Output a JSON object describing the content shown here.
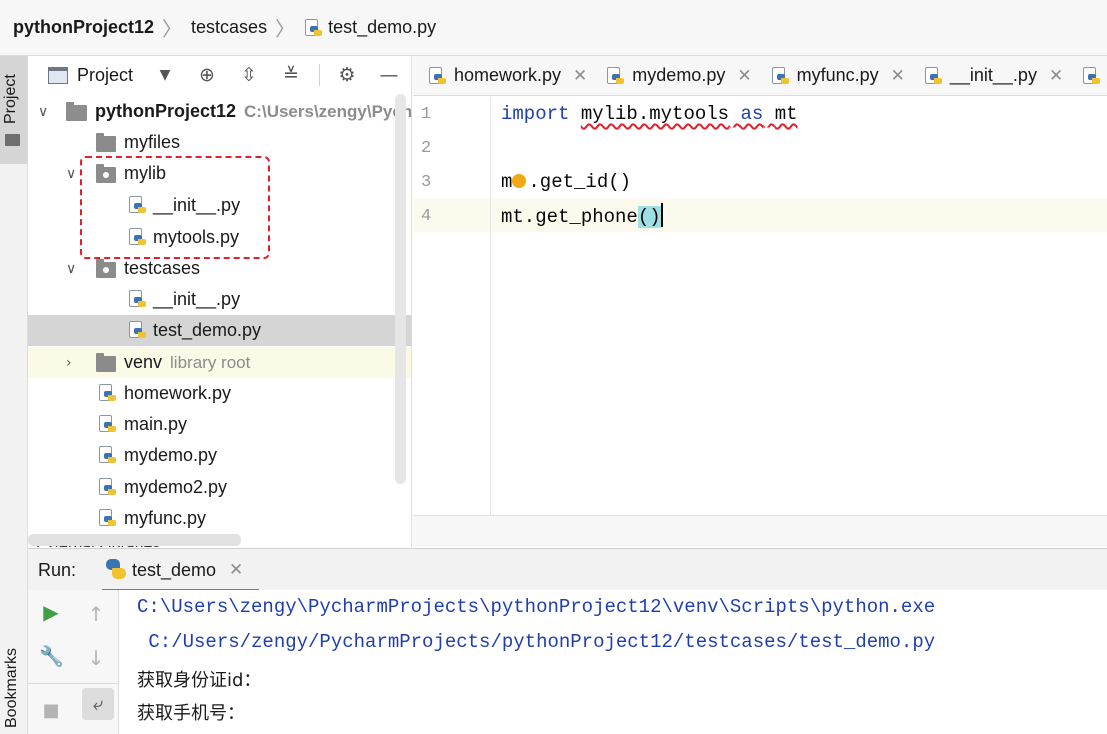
{
  "breadcrumb": {
    "project": "pythonProject12",
    "folder": "testcases",
    "file": "test_demo.py"
  },
  "left_strip": {
    "project_tab": "Project",
    "bookmarks_tab": "Bookmarks"
  },
  "project_panel": {
    "title": "Project",
    "icons": [
      "chevron-down-icon",
      "locate-icon",
      "expand-all-icon",
      "collapse-all-icon",
      "gear-icon",
      "minimize-icon"
    ],
    "tree": {
      "root_name": "pythonProject12",
      "root_path": "C:\\Users\\zengy\\Pych",
      "myfiles": "myfiles",
      "mylib": "mylib",
      "mylib_init": "__init__.py",
      "mylib_mytools": "mytools.py",
      "testcases": "testcases",
      "tc_init": "__init__.py",
      "tc_test_demo": "test_demo.py",
      "venv": "venv",
      "venv_hint": "library root",
      "homework": "homework.py",
      "main": "main.py",
      "mydemo": "mydemo.py",
      "mydemo2": "mydemo2.py",
      "myfunc": "myfunc.py",
      "external": "External Libraries"
    }
  },
  "editor": {
    "tabs": [
      {
        "label": "homework.py"
      },
      {
        "label": "mydemo.py"
      },
      {
        "label": "myfunc.py"
      },
      {
        "label": "__init__.py"
      }
    ],
    "line_numbers": [
      "1",
      "2",
      "3",
      "4"
    ],
    "code": {
      "l1_kw1": "import",
      "l1_mod": "mylib.mytools",
      "l1_kw2": "as",
      "l1_alias": "mt",
      "l3_a": "m",
      "l3_b": ".get_id()",
      "l4_a": "mt.get_phone",
      "l4_b": "()"
    }
  },
  "run": {
    "label": "Run:",
    "tab": "test_demo",
    "console": {
      "line1": "C:\\Users\\zengy\\PycharmProjects\\pythonProject12\\venv\\Scripts\\python.exe",
      "line2": " C:/Users/zengy/PycharmProjects/pythonProject12/testcases/test_demo.py",
      "line3": "获取身份证id：",
      "line4": "获取手机号："
    }
  },
  "colors": {
    "keyword": "#1f3fae",
    "highlight_box": "#e0202a",
    "selected_row": "#d5d5d5",
    "paren_match": "#9ddfe3"
  }
}
